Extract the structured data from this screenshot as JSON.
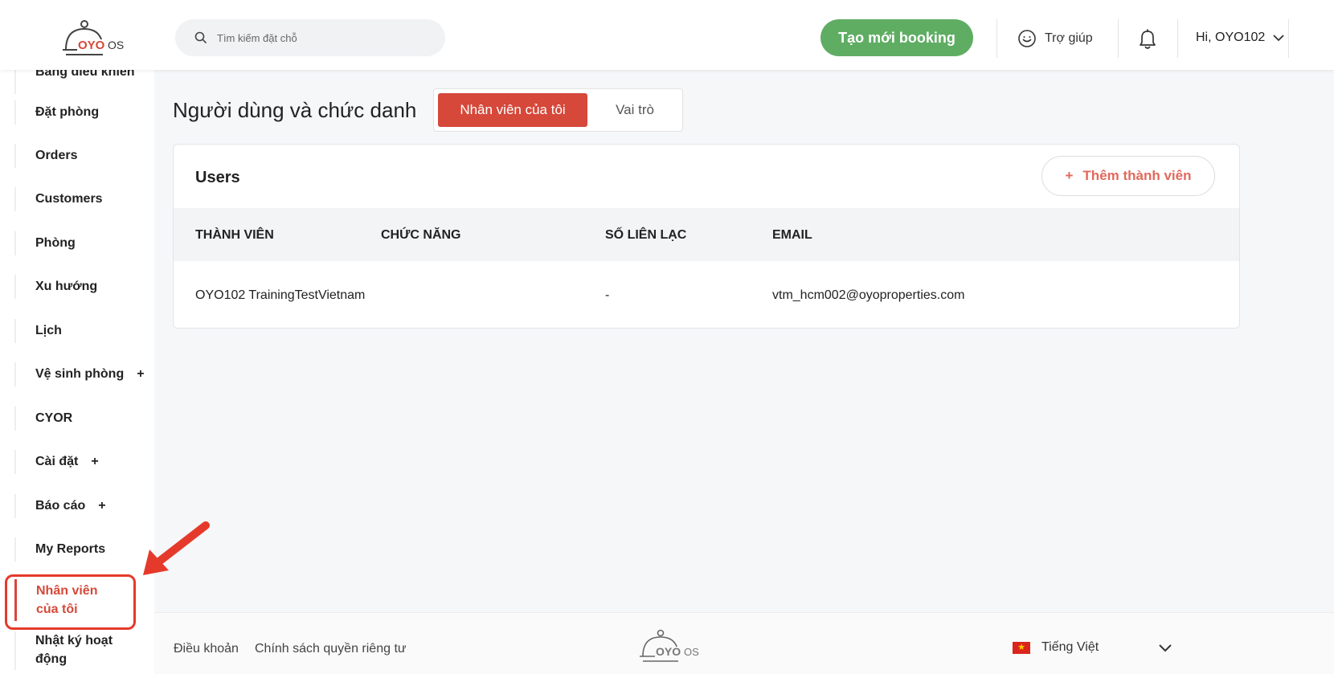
{
  "header": {
    "brand": "OYO",
    "brand_suffix": "OS",
    "search_placeholder": "Tìm kiếm đặt chỗ",
    "new_booking_label": "Tạo mới booking",
    "help_label": "Trợ giúp",
    "user_greeting": "Hi, OYO102"
  },
  "sidebar": {
    "items": [
      {
        "label": "Bảng điều khiển"
      },
      {
        "label": "Đặt phòng"
      },
      {
        "label": "Orders"
      },
      {
        "label": "Customers"
      },
      {
        "label": "Phòng"
      },
      {
        "label": "Xu hướng"
      },
      {
        "label": "Lịch"
      },
      {
        "label": "Vệ sinh phòng",
        "expand": "+"
      },
      {
        "label": "CYOR"
      },
      {
        "label": "Cài đặt",
        "expand": "+"
      },
      {
        "label": "Báo cáo",
        "expand": "+"
      },
      {
        "label": "My Reports"
      },
      {
        "label": "Nhân viên của tôi",
        "active": true
      },
      {
        "label": "Nhật ký hoạt động"
      }
    ]
  },
  "main": {
    "page_title": "Người dùng và chức danh",
    "tabs": [
      {
        "label": "Nhân viên của tôi",
        "active": true
      },
      {
        "label": "Vai trò",
        "active": false
      }
    ],
    "card": {
      "title": "Users",
      "add_button_plus": "+",
      "add_button_label": "Thêm thành viên",
      "columns": [
        "THÀNH VIÊN",
        "CHỨC NĂNG",
        "SỐ LIÊN LẠC",
        "EMAIL"
      ],
      "rows": [
        {
          "member": "OYO102 TrainingTestVietnam",
          "role": "",
          "contact": "-",
          "email": "vtm_hcm002@oyoproperties.com"
        }
      ]
    }
  },
  "footer": {
    "terms": "Điều khoản",
    "privacy": "Chính sách quyền riêng tư",
    "brand": "OYO",
    "brand_suffix": "OS",
    "language": "Tiếng Việt",
    "flag_star": "★"
  },
  "colors": {
    "brand_red": "#d5483a",
    "accent_green": "#5fad63",
    "annotation_red": "#e53a2b"
  }
}
